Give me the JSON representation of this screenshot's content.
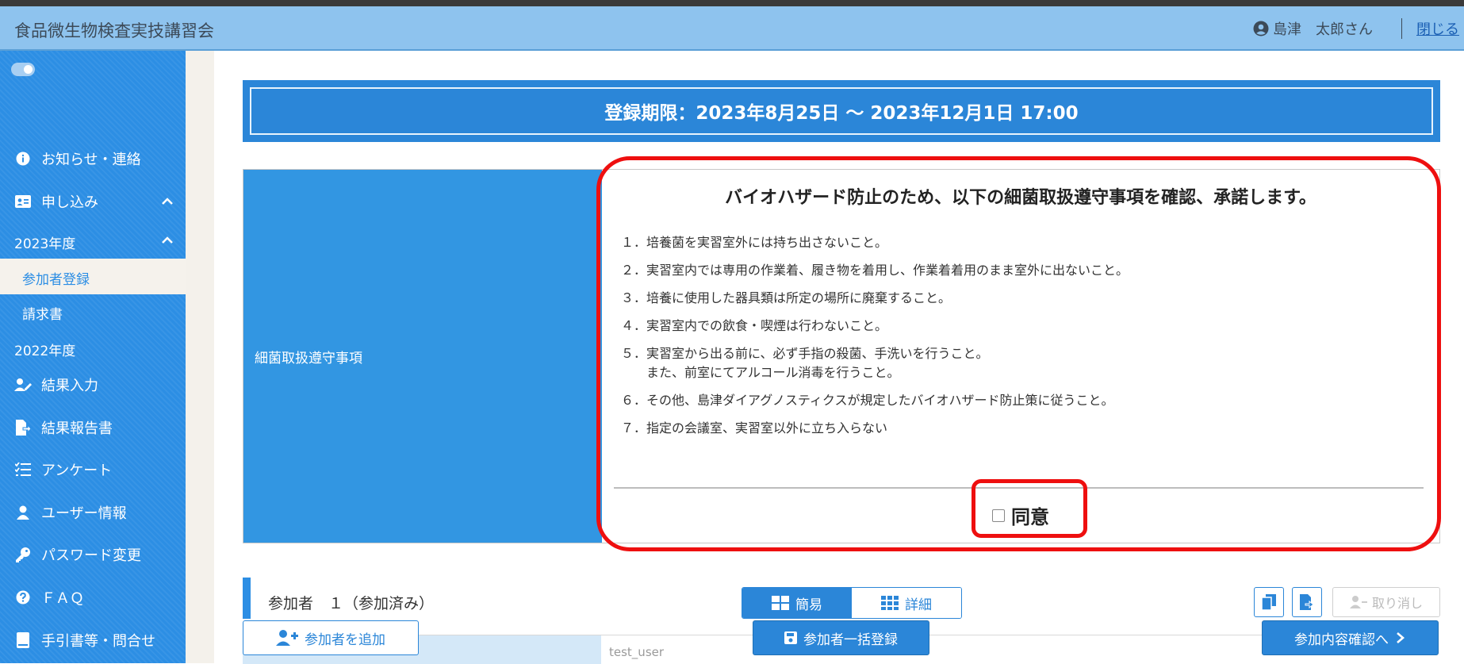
{
  "app": {
    "title": "食品微生物検査実技講習会"
  },
  "user": {
    "name": "島津　太郎さん",
    "close_label": "閉じる"
  },
  "sidebar": {
    "items": [
      {
        "label": "お知らせ・連絡"
      },
      {
        "label": "申し込み"
      },
      {
        "label": "2023年度"
      },
      {
        "label": "参加者登録"
      },
      {
        "label": "請求書"
      },
      {
        "label": "2022年度"
      },
      {
        "label": "結果入力"
      },
      {
        "label": "結果報告書"
      },
      {
        "label": "アンケート"
      },
      {
        "label": "ユーザー情報"
      },
      {
        "label": "パスワード変更"
      },
      {
        "label": "ＦＡＱ"
      },
      {
        "label": "手引書等・問合せ"
      }
    ]
  },
  "period": {
    "text": "登録期限：2023年8月25日 ～ 2023年12月1日 17:00"
  },
  "rules": {
    "label": "細菌取扱遵守事項",
    "heading": "バイオハザード防止のため、以下の細菌取扱遵守事項を確認、承諾します。",
    "items": [
      "１．培養菌を実習室外には持ち出さないこと。",
      "２．実習室内では専用の作業着、履き物を着用し、作業着着用のまま室外に出ないこと。",
      "３．培養に使用した器具類は所定の場所に廃棄すること。",
      "４．実習室内での飲食・喫煙は行わないこと。",
      "５．実習室から出る前に、必ず手指の殺菌、手洗いを行うこと。",
      "　　また、前室にてアルコール消毒を行うこと。",
      "６．その他、島津ダイアグノスティクスが規定したバイオハザード防止策に従うこと。",
      "７．指定の会議室、実習室以外に立ち入らない"
    ],
    "agree_label": "同意",
    "agree_checked": false
  },
  "participants": {
    "title": "参加者　１（参加済み）",
    "view_simple": "簡易",
    "view_detail": "詳細",
    "undo_label": "取り消し",
    "first_value": "test_user"
  },
  "footer": {
    "add_label": "参加者を追加",
    "bulk_label": "参加者一括登録",
    "next_label": "参加内容確認へ"
  },
  "colors": {
    "accent": "#2b86d8",
    "header": "#8ec3ee",
    "highlight": "#ee0f0f"
  }
}
